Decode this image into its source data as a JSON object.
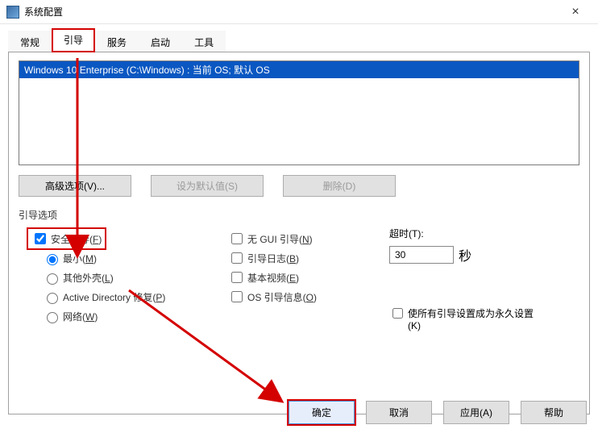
{
  "window": {
    "title": "系统配置"
  },
  "tabs": {
    "items": [
      {
        "label": "常规"
      },
      {
        "label": "引导"
      },
      {
        "label": "服务"
      },
      {
        "label": "启动"
      },
      {
        "label": "工具"
      }
    ]
  },
  "os_list": {
    "items": [
      {
        "text": "Windows 10 Enterprise (C:\\Windows) : 当前 OS; 默认 OS"
      }
    ]
  },
  "buttons_row": {
    "advanced": "高级选项(V)...",
    "set_default": "设为默认值(S)",
    "delete": "删除(D)"
  },
  "boot_options": {
    "group_label": "引导选项",
    "safe_boot": {
      "label_pre": "安全引导(",
      "hot": "F",
      "label_post": ")"
    },
    "radios": {
      "minimal": {
        "pre": "最小(",
        "hot": "M",
        "post": ")"
      },
      "alt_shell": {
        "pre": "其他外壳(",
        "hot": "L",
        "post": ")"
      },
      "ad_repair": {
        "pre": "Active Directory 修复(",
        "hot": "P",
        "post": ")"
      },
      "network": {
        "pre": "网络(",
        "hot": "W",
        "post": ")"
      }
    },
    "checks": {
      "no_gui": {
        "pre": "无 GUI 引导(",
        "hot": "N",
        "post": ")"
      },
      "boot_log": {
        "pre": "引导日志(",
        "hot": "B",
        "post": ")"
      },
      "base_video": {
        "pre": "基本视频(",
        "hot": "E",
        "post": ")"
      },
      "os_info": {
        "pre": "OS 引导信息(",
        "hot": "O",
        "post": ")"
      }
    }
  },
  "timeout": {
    "label_pre": "超时(",
    "hot": "T",
    "label_post": "):",
    "value": "30",
    "unit": "秒"
  },
  "permanent": {
    "line1": "使所有引导设置成为永久设置",
    "hot_pre": "(",
    "hot": "K",
    "hot_post": ")"
  },
  "dialog_buttons": {
    "ok": "确定",
    "cancel": "取消",
    "apply_pre": "应用(",
    "apply_hot": "A",
    "apply_post": ")",
    "help": "帮助"
  }
}
